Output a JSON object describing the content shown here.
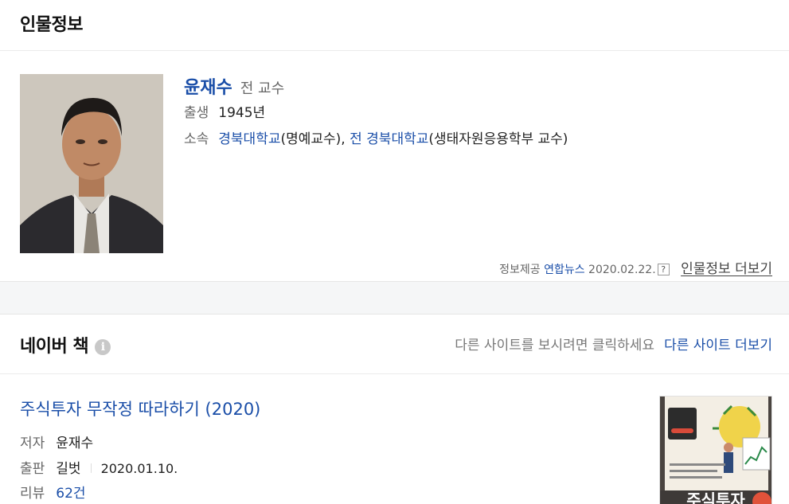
{
  "person": {
    "section_title": "인물정보",
    "name": "윤재수",
    "title": "전 교수",
    "birth_label": "출생",
    "birth_value": "1945년",
    "affil_label": "소속",
    "affil_school1": "경북대학교",
    "affil_role1": "(명예교수), ",
    "affil_prefix2": "전 ",
    "affil_school2": "경북대학교",
    "affil_role2": "(생태자원응용학부 교수)",
    "source_label": "정보제공",
    "source_provider": "연합뉴스",
    "source_date": "2020.02.22.",
    "help_glyph": "?",
    "more_link": "인물정보 더보기"
  },
  "books": {
    "section_title": "네이버 책",
    "info_glyph": "i",
    "hint": "다른 사이트를 보시려면 클릭하세요",
    "more_sites": "다른 사이트 더보기",
    "item": {
      "title": "주식투자 무작정 따라하기 (2020)",
      "author_label": "저자",
      "author": "윤재수",
      "publisher_label": "출판",
      "publisher": "길벗",
      "date": "2020.01.10.",
      "review_label": "리뷰",
      "review_count": "62건",
      "cover_text": "주식투자"
    }
  },
  "colors": {
    "link": "#1a4ea8",
    "label": "#666666",
    "band": "#f5f6f7"
  },
  "icons": [
    "question-mark-icon",
    "info-icon"
  ]
}
